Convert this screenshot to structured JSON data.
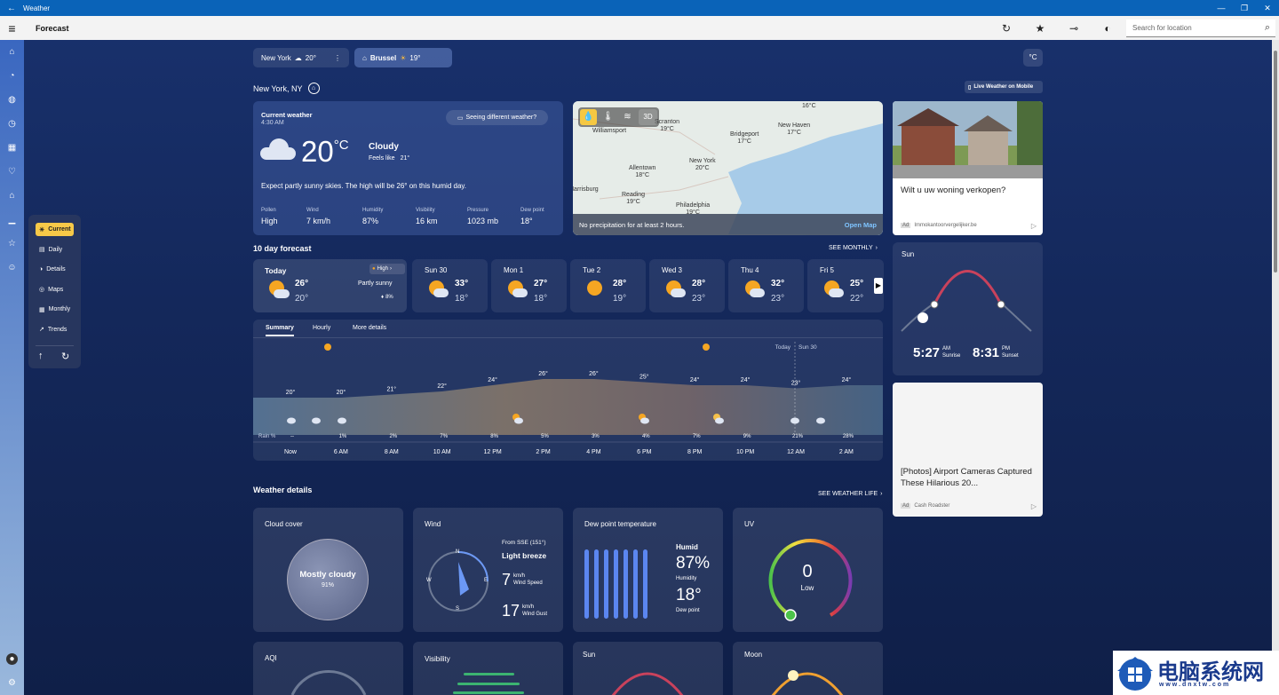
{
  "window": {
    "title": "Weather"
  },
  "topbar": {
    "title": "Forecast",
    "search_placeholder": "Search for location"
  },
  "locations": [
    {
      "name": "New York",
      "temp": "20°",
      "icon": "cloud-icon"
    },
    {
      "name": "Brussel",
      "temp": "19°",
      "icon": "partly-sunny-icon",
      "selected": true
    }
  ],
  "unit_button": "°C",
  "location_title": "New York, NY",
  "live_weather_label": "Live Weather on Mobile",
  "current": {
    "header": "Current weather",
    "time": "4:30 AM",
    "seeing_different": "Seeing different weather?",
    "temp": "20",
    "unit": "°C",
    "condition": "Cloudy",
    "feels_like_label": "Feels like",
    "feels_like": "21°",
    "summary": "Expect partly sunny skies. The high will be 26° on this humid day.",
    "stats": [
      {
        "label": "Pollen",
        "value": "High"
      },
      {
        "label": "Wind",
        "value": "7 km/h"
      },
      {
        "label": "Humidity",
        "value": "87%"
      },
      {
        "label": "Visibility",
        "value": "16 km"
      },
      {
        "label": "Pressure",
        "value": "1023 mb"
      },
      {
        "label": "Dew point",
        "value": "18°"
      }
    ]
  },
  "map": {
    "mode_3d": "3D",
    "footer": "No precipitation for at least 2 hours.",
    "open_map": "Open Map",
    "places": [
      {
        "name": "Williamsport",
        "temp": ""
      },
      {
        "name": "Scranton",
        "temp": "19°C"
      },
      {
        "name": "Bridgeport",
        "temp": "17°C"
      },
      {
        "name": "New Haven",
        "temp": "17°C"
      },
      {
        "name": "Allentown",
        "temp": "18°C"
      },
      {
        "name": "New York",
        "temp": "20°C"
      },
      {
        "name": "Reading",
        "temp": "19°C"
      },
      {
        "name": "Philadelphia",
        "temp": "19°C"
      },
      {
        "name": "Harrisburg",
        "temp": ""
      },
      {
        "name": "",
        "temp": "16°C"
      }
    ]
  },
  "ad1": {
    "title": "Wilt u uw woning verkopen?",
    "source": "Immokantoorvergelijker.be",
    "badge": "Ad"
  },
  "ad2": {
    "title": "[Photos] Airport Cameras Captured These Hilarious 20...",
    "source": "Cash Roadster",
    "badge": "Ad"
  },
  "forecast": {
    "title": "10 day forecast",
    "see_monthly": "SEE MONTHLY",
    "today": {
      "day": "Today",
      "high": "26°",
      "low": "20°",
      "condition": "Partly sunny",
      "precip": "8%",
      "badge": "High"
    },
    "days": [
      {
        "day": "Sun 30",
        "high": "33°",
        "low": "18°"
      },
      {
        "day": "Mon 1",
        "high": "27°",
        "low": "18°"
      },
      {
        "day": "Tue 2",
        "high": "28°",
        "low": "19°"
      },
      {
        "day": "Wed 3",
        "high": "28°",
        "low": "23°"
      },
      {
        "day": "Thu 4",
        "high": "32°",
        "low": "23°"
      },
      {
        "day": "Fri 5",
        "high": "25°",
        "low": "22°"
      }
    ]
  },
  "hourly": {
    "tabs": [
      "Summary",
      "Hourly",
      "More details"
    ],
    "today_label": "Today",
    "next_label": "Sun 30",
    "rain_label": "Rain %",
    "times": [
      "Now",
      "6 AM",
      "8 AM",
      "10 AM",
      "12 PM",
      "2 PM",
      "4 PM",
      "6 PM",
      "8 PM",
      "10 PM",
      "12 AM",
      "2 AM"
    ],
    "temps": [
      "20°",
      "20°",
      "21°",
      "22°",
      "24°",
      "26°",
      "26°",
      "25°",
      "24°",
      "24°",
      "23°",
      "24°"
    ],
    "temp_values": [
      20,
      20,
      21,
      22,
      24,
      26,
      26,
      25,
      24,
      24,
      23,
      24
    ],
    "rain": [
      "--",
      "1%",
      "2%",
      "7%",
      "8%",
      "5%",
      "3%",
      "4%",
      "7%",
      "9%",
      "21%",
      "28%"
    ]
  },
  "sun_card": {
    "title": "Sun",
    "sunrise": "5:27",
    "sunrise_ampm": "AM",
    "sunrise_label": "Sunrise",
    "sunset": "8:31",
    "sunset_ampm": "PM",
    "sunset_label": "Sunset"
  },
  "details": {
    "title": "Weather details",
    "see_life": "SEE WEATHER LIFE",
    "cloud": {
      "title": "Cloud cover",
      "value": "Mostly cloudy",
      "percent": "91%"
    },
    "wind": {
      "title": "Wind",
      "from": "From SSE (151°)",
      "desc": "Light breeze",
      "speed": "7",
      "speed_unit": "km/h",
      "speed_label": "Wind Speed",
      "gust": "17",
      "gust_unit": "km/h",
      "gust_label": "Wind Gust",
      "n": "N",
      "e": "E",
      "s": "S",
      "w": "W"
    },
    "dew": {
      "title": "Dew point temperature",
      "humid_label": "Humid",
      "humidity": "87%",
      "humidity_label": "Humidity",
      "dew": "18°",
      "dew_label": "Dew point"
    },
    "uv": {
      "title": "UV",
      "value": "0",
      "level": "Low"
    },
    "aqi": {
      "title": "AQI"
    },
    "visibility": {
      "title": "Visibility"
    },
    "sun": {
      "title": "Sun"
    },
    "moon": {
      "title": "Moon"
    }
  },
  "nav": [
    "Current",
    "Daily",
    "Details",
    "Maps",
    "Monthly",
    "Trends"
  ],
  "watermark": {
    "text": "电脑系统网",
    "url": "w w w . d n x t w . c o m"
  }
}
